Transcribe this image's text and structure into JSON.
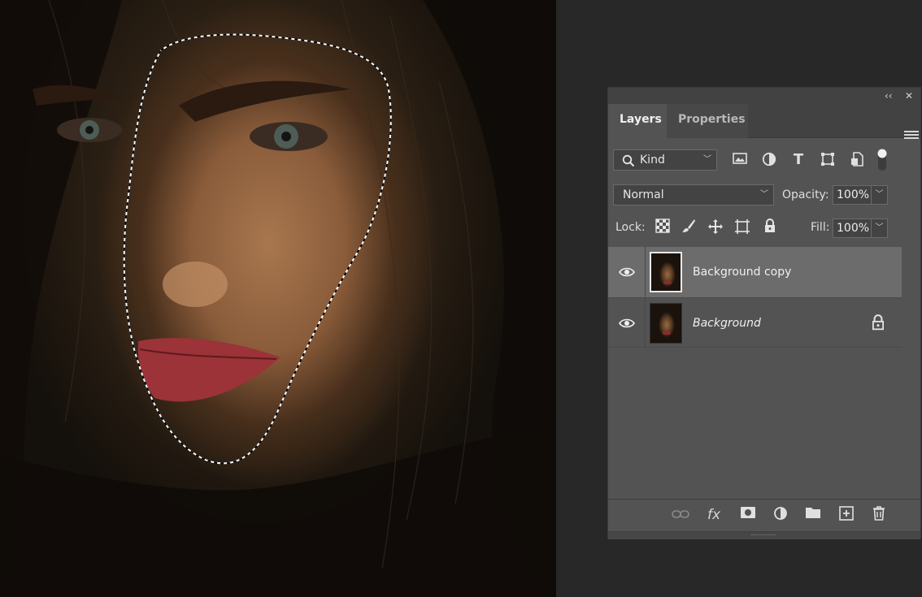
{
  "panel": {
    "collapse_label": "‹‹",
    "close_label": "✕",
    "tabs": [
      {
        "label": "Layers",
        "active": true
      },
      {
        "label": "Properties",
        "active": false
      }
    ],
    "filter": {
      "kind_label": "Kind",
      "icons": [
        "image-filter-icon",
        "adjustment-filter-icon",
        "type-filter-icon",
        "shape-filter-icon",
        "smart-object-filter-icon",
        "filter-toggle-icon"
      ]
    },
    "blend_mode": "Normal",
    "opacity_label": "Opacity:",
    "opacity_value": "100%",
    "lock_label": "Lock:",
    "fill_label": "Fill:",
    "fill_value": "100%",
    "layers": [
      {
        "name": "Background copy",
        "selected": true,
        "locked": false,
        "visible": true
      },
      {
        "name": "Background",
        "selected": false,
        "locked": true,
        "visible": true
      }
    ],
    "bottom_icons": [
      "link-layers-icon",
      "fx-icon",
      "add-mask-icon",
      "adjustment-layer-icon",
      "new-group-icon",
      "new-layer-icon",
      "delete-layer-icon"
    ],
    "fx_label": "fx"
  },
  "colors": {
    "panel_bg": "#535353",
    "selected_row": "#6c6c6c",
    "workspace_bg": "#282828"
  }
}
